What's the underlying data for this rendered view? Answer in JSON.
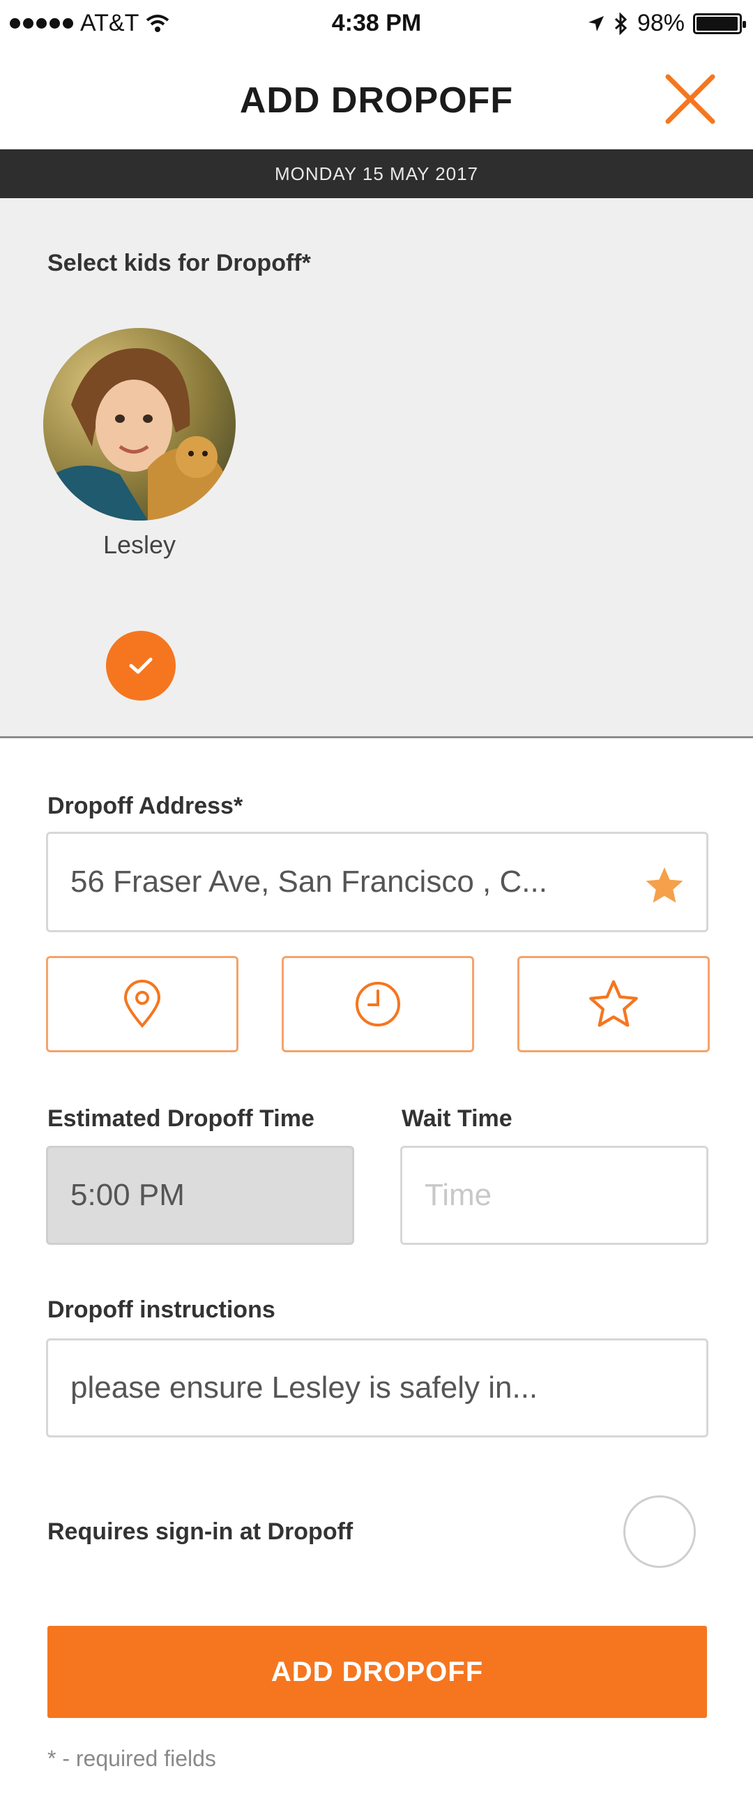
{
  "status_bar": {
    "carrier": "AT&T",
    "time": "4:38 PM",
    "battery": "98%",
    "battery_level": 0.98
  },
  "header": {
    "title": "ADD DROPOFF",
    "close_icon": "close-icon"
  },
  "date_bar": {
    "text": "MONDAY 15 MAY 2017"
  },
  "kids": {
    "label": "Select kids for Dropoff*",
    "items": [
      {
        "name": "Lesley",
        "selected": true
      }
    ]
  },
  "address": {
    "label": "Dropoff Address*",
    "value": "56 Fraser Ave, San Francisco , C...",
    "favorite_icon": "star-filled-icon",
    "buttons": [
      {
        "icon": "location-pin-icon"
      },
      {
        "icon": "clock-icon"
      },
      {
        "icon": "star-outline-icon"
      }
    ]
  },
  "times": {
    "estimated_label": "Estimated Dropoff Time",
    "estimated_value": "5:00 PM",
    "wait_label": "Wait Time",
    "wait_placeholder": "Time"
  },
  "instructions": {
    "label": "Dropoff instructions",
    "value": "please ensure Lesley is safely in..."
  },
  "sign_in": {
    "label": "Requires sign-in at Dropoff",
    "checked": false
  },
  "submit": {
    "label": "ADD DROPOFF"
  },
  "footnote": "* - required fields",
  "colors": {
    "accent": "#f5761f",
    "dark_bar": "#2e2e2e",
    "section_bg": "#efefef"
  }
}
